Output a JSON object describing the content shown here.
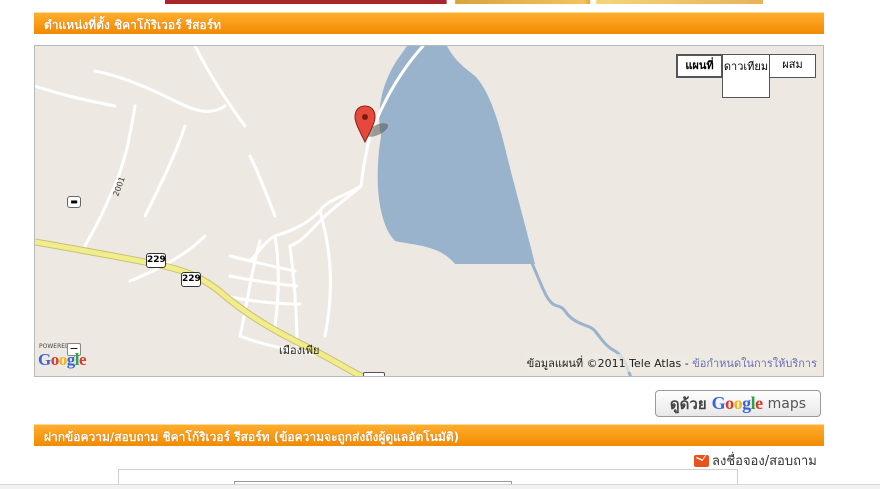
{
  "section_location": {
    "title": "ตำแหน่งที่ตั้ง ชิคาโก้ริเวอร์ รีสอร์ท"
  },
  "map": {
    "type_buttons": [
      {
        "label": "แผนที่",
        "active": true
      },
      {
        "label": "ดาวเทียม",
        "active": false
      },
      {
        "label": "ผสม",
        "active": false
      }
    ],
    "road_label": "2001",
    "route_shield_1": "229",
    "route_shield_2": "229",
    "town_label": "เมืองเพีย",
    "powered_by": "POWERED BY",
    "google_logo": "Google",
    "copyright_text": "ข้อมูลแผนที่ ©2011 Tele Atlas - ",
    "terms_link": "ข้อกำหนดในการให้บริการ",
    "colors": {
      "water": "#99b3cc",
      "land": "#ede9e2",
      "road": "#ffffff",
      "highway": "#f2ed8c",
      "pin": "#e4493b"
    }
  },
  "gmaps_button": {
    "prefix": "ดูด้วย",
    "logo": "Google",
    "suffix": "maps"
  },
  "section_message": {
    "title": "ฝากข้อความ/สอบถาม ชิคาโก้ริเวอร์ รีสอร์ท (ข้อความจะถูกส่งถึงผู้ดูแลอัตโนมัติ)"
  },
  "contact_link": {
    "label": "ลงชื่อจอง/สอบถาม",
    "icon": "envelope-icon"
  }
}
